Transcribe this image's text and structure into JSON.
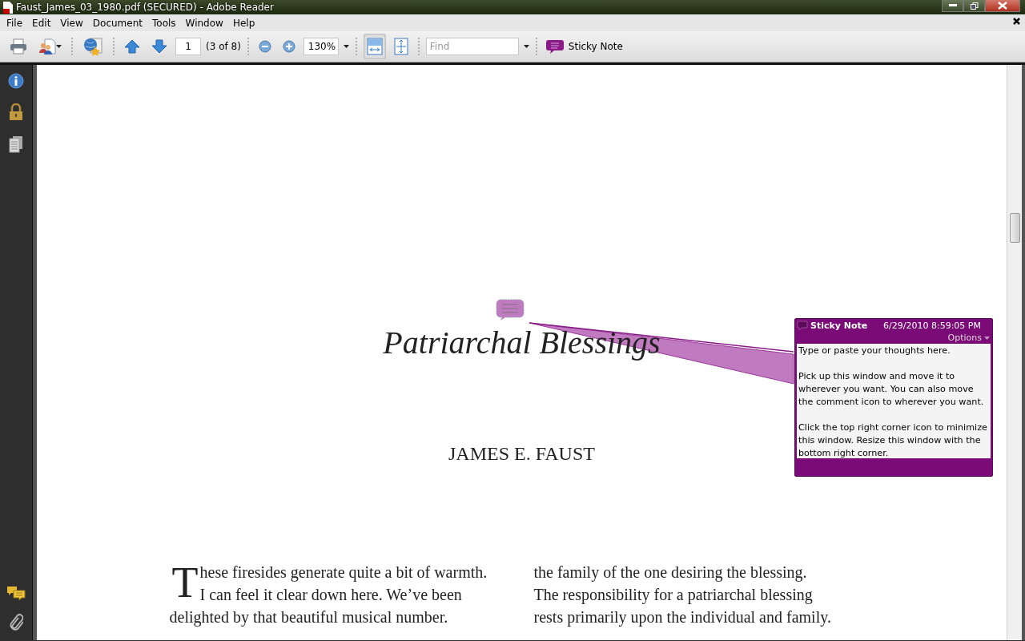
{
  "window": {
    "title": "Faust_James_03_1980.pdf (SECURED) - Adobe Reader"
  },
  "menu": [
    "File",
    "Edit",
    "View",
    "Document",
    "Tools",
    "Window",
    "Help"
  ],
  "toolbar": {
    "page_number": "1",
    "page_count": "(3 of 8)",
    "zoom": "130%",
    "fit_width_selected": true,
    "fit_page_selected": false,
    "find_placeholder": "Find",
    "sticky_note_label": "Sticky Note"
  },
  "document": {
    "title": "Patriarchal Blessings",
    "author": "JAMES E. FAUST",
    "left_column": {
      "drop_cap": "T",
      "lines": [
        "hese firesides generate quite a bit of warmth.",
        "I can feel it clear down here. We’ve been",
        "delighted by that beautiful musical number."
      ]
    },
    "right_column": {
      "lines": [
        "the family of the one desiring the blessing.",
        "The responsibility for a patriarchal blessing",
        "rests primarily upon the individual and family."
      ]
    }
  },
  "sticky_note": {
    "title": "Sticky Note",
    "timestamp": "6/29/2010 8:59:05 PM",
    "options": "Options",
    "paragraphs": [
      "Type or paste your thoughts here.",
      "Pick up this window and move it to wherever you want. You can also move the comment icon to wherever you want.",
      "Click the top right corner icon to minimize this window. Resize this window with the bottom right corner."
    ]
  }
}
